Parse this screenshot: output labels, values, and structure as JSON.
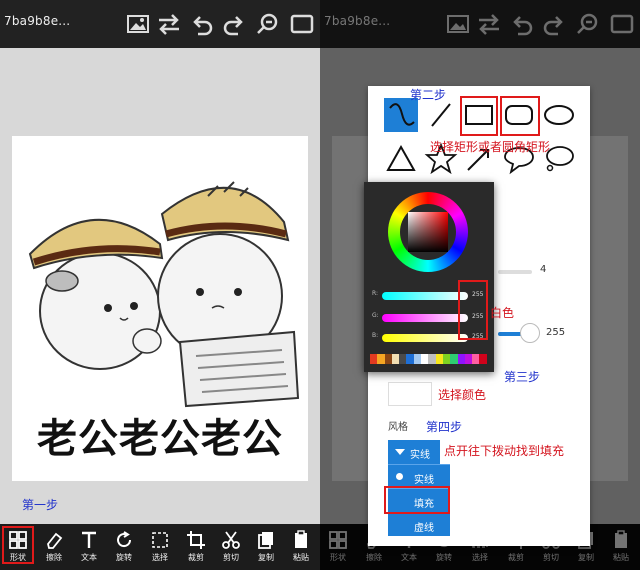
{
  "file_title": "7ba9b8e...",
  "file_title_dim": "7ba9b8e...",
  "toolbar_icons": [
    "image-icon",
    "swap-icon",
    "undo-icon",
    "redo-icon",
    "zoom-out-icon",
    "fullscreen-icon"
  ],
  "bottom_tools": [
    {
      "label": "形状",
      "icon": "shapes-icon"
    },
    {
      "label": "擦除",
      "icon": "eraser-icon"
    },
    {
      "label": "文本",
      "icon": "text-icon"
    },
    {
      "label": "旋转",
      "icon": "rotate-icon"
    },
    {
      "label": "选择",
      "icon": "select-icon"
    },
    {
      "label": "裁剪",
      "icon": "crop-icon"
    },
    {
      "label": "剪切",
      "icon": "cut-icon"
    },
    {
      "label": "复制",
      "icon": "copy-icon"
    },
    {
      "label": "粘贴",
      "icon": "paste-icon"
    }
  ],
  "meme_caption": "老公老公老公",
  "shape_panel": {
    "stroke_width_value": "4",
    "opacity_value": "255",
    "style_label": "风格",
    "style_current": "实线",
    "style_options": [
      "实线",
      "填充",
      "虚线"
    ]
  },
  "color_picker": {
    "r_label": "R:",
    "g_label": "G:",
    "b_label": "B:",
    "r_value": "255",
    "g_value": "255",
    "b_value": "255",
    "palette": [
      "#e23a20",
      "#f5a623",
      "#8b4513",
      "#f2dfb3",
      "#4a4a4a",
      "#1e6fd6",
      "#a3c9f1",
      "#ffffff",
      "#c0c0c0",
      "#f8e71c",
      "#7ed321",
      "#2ecc71",
      "#9013fe",
      "#bd10e0",
      "#ff5fa2",
      "#d0021b"
    ]
  },
  "annotations": {
    "step1": "第一步",
    "step2": "第二步",
    "step2_text": "选择矩形或者圆角矩形",
    "white": "白色",
    "step3": "第三步",
    "select_color": "选择颜色",
    "step4": "第四步",
    "step4_text": "点开往下拨动找到填充"
  },
  "colors": {
    "accent": "#1e7fd6",
    "annotation_red": "#d4141e",
    "annotation_blue": "#2233cc"
  }
}
